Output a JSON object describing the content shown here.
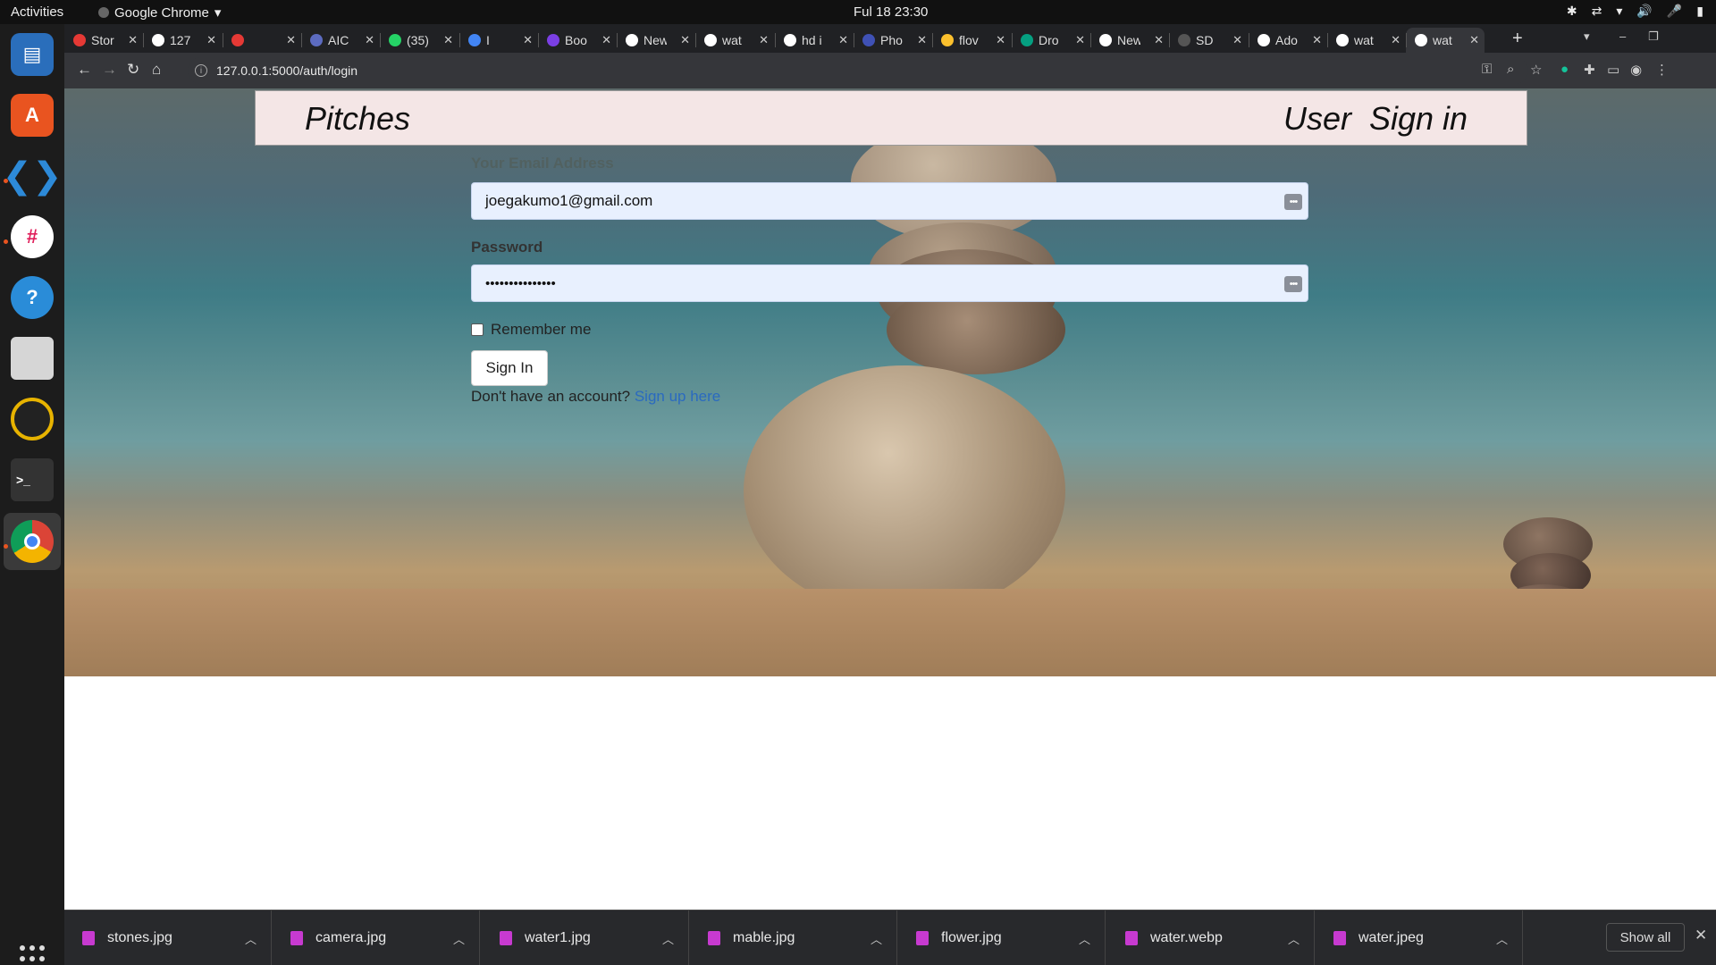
{
  "topbar": {
    "activities": "Activities",
    "app_name": "Google Chrome",
    "clock": "Ful 18  23:30"
  },
  "tabs": [
    {
      "title": "Stor",
      "color": "#e53935"
    },
    {
      "title": "127",
      "color": "#ffffff"
    },
    {
      "title": "",
      "color": "#e53935"
    },
    {
      "title": "AIC",
      "color": "#5c6bc0"
    },
    {
      "title": "(35)",
      "color": "#25d366"
    },
    {
      "title": "I",
      "color": "#4285f4"
    },
    {
      "title": "Boo",
      "color": "#7b3fe4"
    },
    {
      "title": "New",
      "color": "#ffffff"
    },
    {
      "title": "wat",
      "color": "#ffffff"
    },
    {
      "title": "hd i",
      "color": "#ffffff"
    },
    {
      "title": "Pho",
      "color": "#3f51b5"
    },
    {
      "title": "flov",
      "color": "#fbc02d"
    },
    {
      "title": "Dro",
      "color": "#05a081"
    },
    {
      "title": "New",
      "color": "#ffffff"
    },
    {
      "title": "SD",
      "color": "#555555"
    },
    {
      "title": "Ado",
      "color": "#ffffff"
    },
    {
      "title": "wat",
      "color": "#ffffff"
    },
    {
      "title": "wat",
      "color": "#ffffff"
    }
  ],
  "toolbar": {
    "url": "127.0.0.1:5000/auth/login"
  },
  "site": {
    "brand": "Pitches",
    "nav_user": "User",
    "nav_signin": "Sign in"
  },
  "form": {
    "email_label": "Your Email Address",
    "email_value": "joegakumo1@gmail.com",
    "password_label": "Password",
    "password_value": "•••••••••••••••",
    "remember_label": "Remember me",
    "submit_label": "Sign In",
    "no_account_text": "Don't have an account?",
    "signup_link": "Sign up here"
  },
  "downloads": [
    {
      "name": "stones.jpg"
    },
    {
      "name": "camera.jpg"
    },
    {
      "name": "water1.jpg"
    },
    {
      "name": "mable.jpg"
    },
    {
      "name": "flower.jpg"
    },
    {
      "name": "water.webp"
    },
    {
      "name": "water.jpeg"
    }
  ],
  "shelf": {
    "show_all": "Show all"
  },
  "colors": {
    "navbar_bg": "#f4e6e6",
    "autofill_bg": "#e8f0fe",
    "link": "#2a6ac0",
    "download_icon": "#c73ad0"
  }
}
